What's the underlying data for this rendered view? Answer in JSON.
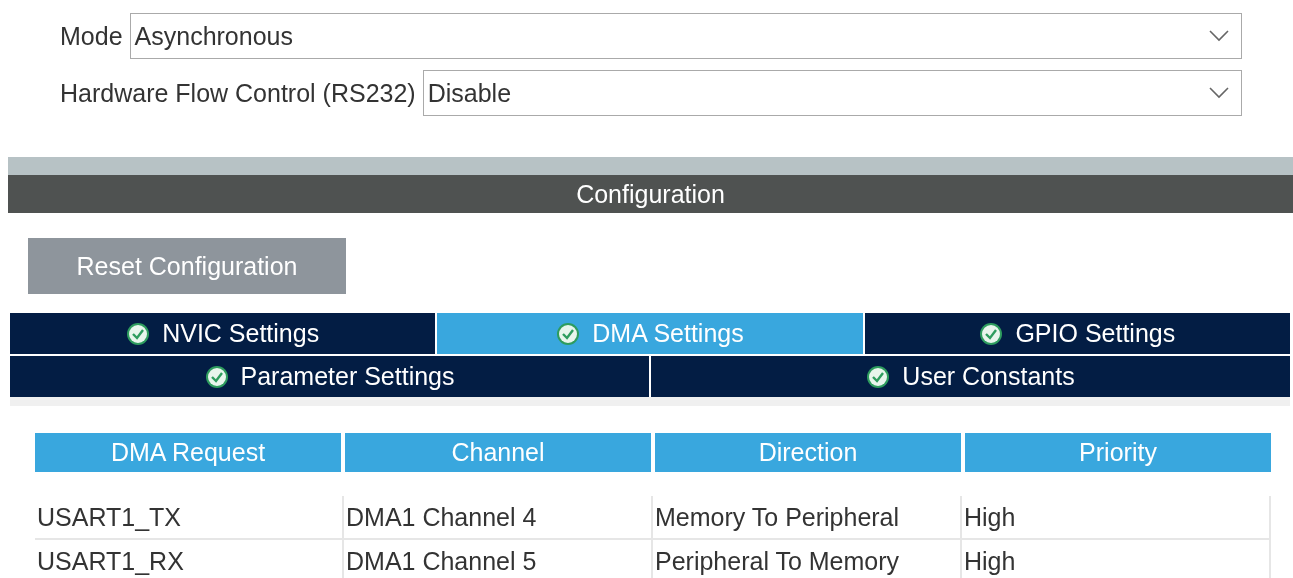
{
  "fields": [
    {
      "label": "Mode",
      "value": "Asynchronous"
    },
    {
      "label": "Hardware Flow Control (RS232)",
      "value": "Disable"
    }
  ],
  "section_title": "Configuration",
  "reset_button": "Reset Configuration",
  "tab_rows": [
    [
      {
        "label": "NVIC Settings",
        "selected": false,
        "ok": true
      },
      {
        "label": "DMA Settings",
        "selected": true,
        "ok": true
      },
      {
        "label": "GPIO Settings",
        "selected": false,
        "ok": true
      }
    ],
    [
      {
        "label": "Parameter Settings",
        "selected": false,
        "ok": true
      },
      {
        "label": "User Constants",
        "selected": false,
        "ok": true
      }
    ]
  ],
  "table": {
    "columns": [
      "DMA Request",
      "Channel",
      "Direction",
      "Priority"
    ],
    "rows": [
      [
        "USART1_TX",
        "DMA1 Channel 4",
        "Memory To Peripheral",
        "High"
      ],
      [
        "USART1_RX",
        "DMA1 Channel 5",
        "Peripheral To Memory",
        "High"
      ]
    ]
  }
}
